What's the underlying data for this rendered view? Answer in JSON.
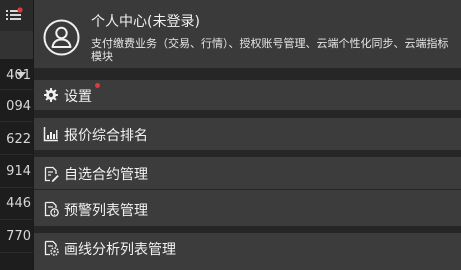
{
  "background": {
    "numbers": [
      "401",
      "094",
      "622",
      "914",
      "446",
      "770"
    ]
  },
  "profile": {
    "title": "个人中心(未登录)",
    "description": "支付缴费业务（交易、行情）、授权账号管理、云端个性化同步、云端指标模块",
    "avatar_icon": "user-avatar-icon"
  },
  "menu": {
    "settings": {
      "label": "设置",
      "icon": "gear-icon",
      "has_notification": true
    },
    "quote_ranking": {
      "label": "报价综合排名",
      "icon": "bar-chart-icon"
    },
    "watchlist": {
      "label": "自选合约管理",
      "icon": "document-edit-icon"
    },
    "alert_list": {
      "label": "预警列表管理",
      "icon": "document-alert-icon"
    },
    "drawing_list": {
      "label": "画线分析列表管理",
      "icon": "document-gear-icon"
    }
  },
  "colors": {
    "notification_dot": "#e0373a",
    "drawer_background": "#343434",
    "text": "#f2f2f2"
  }
}
